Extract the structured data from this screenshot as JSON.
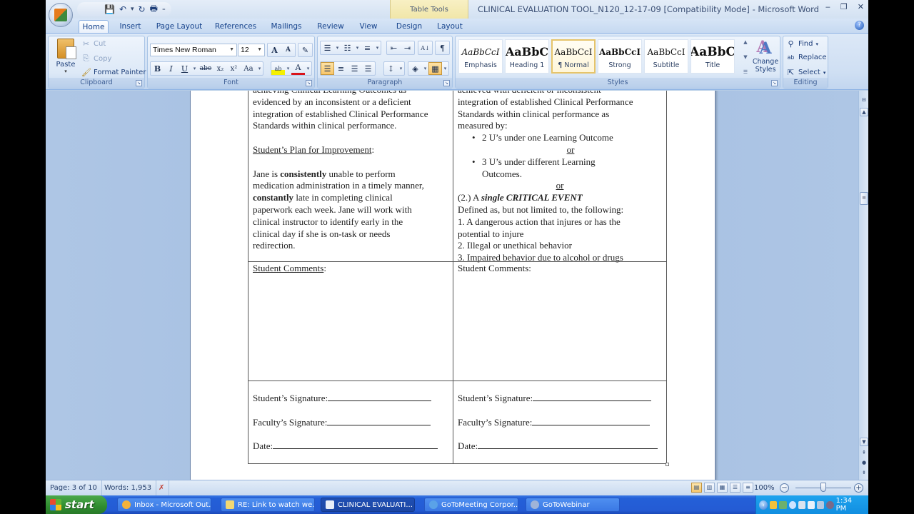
{
  "window": {
    "title": "CLINICAL EVALUATION TOOL_N120_12-17-09 [Compatibility Mode] - Microsoft Word",
    "contextual_header": "Table Tools",
    "controls": [
      "minimize",
      "restore",
      "close"
    ],
    "min_glyph": "‒",
    "restore_glyph": "❐",
    "close_glyph": "✕"
  },
  "qat": {
    "save_icon": "💾",
    "undo_icon": "↶",
    "undo_dd": "▾",
    "redo_icon": "↻",
    "print_icon": "🖶",
    "customize": "₌"
  },
  "tabs": [
    "Home",
    "Insert",
    "Page Layout",
    "References",
    "Mailings",
    "Review",
    "View",
    "Design",
    "Layout"
  ],
  "help_glyph": "?",
  "ribbon": {
    "clipboard": {
      "label": "Clipboard",
      "paste": "Paste",
      "cut": "Cut",
      "copy": "Copy",
      "format_painter": "Format Painter"
    },
    "font": {
      "label": "Font",
      "font_name": "Times New Roman",
      "font_size": "12",
      "grow": "A",
      "shrink": "A",
      "clear": "✎",
      "bold": "B",
      "italic": "I",
      "underline": "U",
      "strike": "abe",
      "subscript": "x₂",
      "superscript": "x²",
      "change_case": "Aa",
      "highlight": "ab",
      "font_color": "A"
    },
    "paragraph": {
      "label": "Paragraph",
      "bullets": "☰",
      "numbering": "☷",
      "multilevel": "≡",
      "decrease_indent": "⇤",
      "increase_indent": "⇥",
      "sort": "A↓",
      "show_marks": "¶",
      "align_left": "☰",
      "center": "≡",
      "align_right": "☰",
      "justify": "☰",
      "line_spacing": "↕",
      "shading": "◈",
      "borders": "▦"
    },
    "styles": {
      "label": "Styles",
      "items": [
        {
          "sample": "AaBbCcI",
          "name": "Emphasis"
        },
        {
          "sample": "AaBbC",
          "name": "Heading 1"
        },
        {
          "sample": "AaBbCcI",
          "name": "¶ Normal"
        },
        {
          "sample": "AaBbCcI",
          "name": "Strong"
        },
        {
          "sample": "AaBbCcI",
          "name": "Subtitle"
        },
        {
          "sample": "AaBbC",
          "name": "Title"
        }
      ],
      "selected": "¶ Normal",
      "change_styles": "Change Styles",
      "change_styles_icon": "A"
    },
    "editing": {
      "label": "Editing",
      "find": "Find",
      "replace": "Replace",
      "select": "Select"
    }
  },
  "document": {
    "left_top": {
      "lines": [
        "achieving Clinical Learning Outcomes as",
        "evidenced by an inconsistent or a deficient",
        "integration of established Clinical Performance",
        "Standards within clinical performance."
      ],
      "plan_heading": "Student’s Plan for Improvement",
      "plan_colon": ":",
      "plan_line1_a": "Jane is ",
      "plan_line1_b": "consistently",
      "plan_line1_c": " unable to perform",
      "plan_line2": "medication administration in a timely manner,",
      "plan_line3_a": "constantly",
      "plan_line3_b": " late in completing clinical",
      "plan_line4": "paperwork each week.  Jane will work with",
      "plan_line5": "clinical instructor to identify early in the",
      "plan_line6": "clinical day if she is on-task or needs",
      "plan_line7": "redirection."
    },
    "right_top": {
      "lines": [
        "achieved with deficient or inconsistent",
        "integration of established Clinical Performance",
        "Standards within clinical performance as",
        "measured by:"
      ],
      "bullet1": "2 U’s under one Learning Outcome",
      "or1": "or",
      "bullet2_l1": "3 U’s under different Learning",
      "bullet2_l2": "Outcomes.",
      "or2": "or",
      "critical_a": "(2.) A ",
      "critical_b": "single",
      "critical_c": " CRITICAL EVENT",
      "defined": "Defined as, but not limited to, the following:",
      "item1_l1": "1. A dangerous action that injures  or has the",
      "item1_l2": "potential to injure",
      "item2": "2. Illegal or unethical behavior",
      "item3": "3. Impaired behavior due to alcohol  or drugs"
    },
    "comments_left": "Student Comments",
    "comments_left_colon": ":",
    "comments_right": "Student Comments:",
    "signatures": {
      "student": "Student’s Signature:",
      "faculty": "Faculty’s Signature:",
      "date": "Date:"
    },
    "bullet_glyph": "•"
  },
  "statusbar": {
    "page": "Page: 3 of 10",
    "words": "Words: 1,953",
    "proofing_icon": "✗",
    "zoom": "100%",
    "zoom_percent": 100,
    "zoom_minus": "−",
    "zoom_plus": "+",
    "views": [
      "Print Layout",
      "Full Screen Reading",
      "Web Layout",
      "Outline",
      "Draft"
    ],
    "active_view": "Print Layout"
  },
  "scrollbar": {
    "up": "▲",
    "down": "▼",
    "prev_page": "⇞",
    "browse": "●",
    "next_page": "⇟",
    "ruler": "⊟",
    "thumb_grip": "≡",
    "position_fraction": 0.3
  },
  "taskbar": {
    "start": "start",
    "items": [
      {
        "label": "Inbox - Microsoft Out...",
        "color": "#f3b23b",
        "active": false
      },
      {
        "label": "RE: Link to watch we...",
        "color": "#f2d873",
        "active": false
      },
      {
        "label": "CLINICAL EVALUATI...",
        "color": "#e8eef8",
        "active": true
      },
      {
        "label": "GoToMeeting Corpor...",
        "color": "#5aa2e8",
        "active": false
      },
      {
        "label": "GoToWebinar",
        "color": "#9fb4d8",
        "active": false
      }
    ],
    "clock": "1:34 PM",
    "tray_chevron": "‹"
  }
}
